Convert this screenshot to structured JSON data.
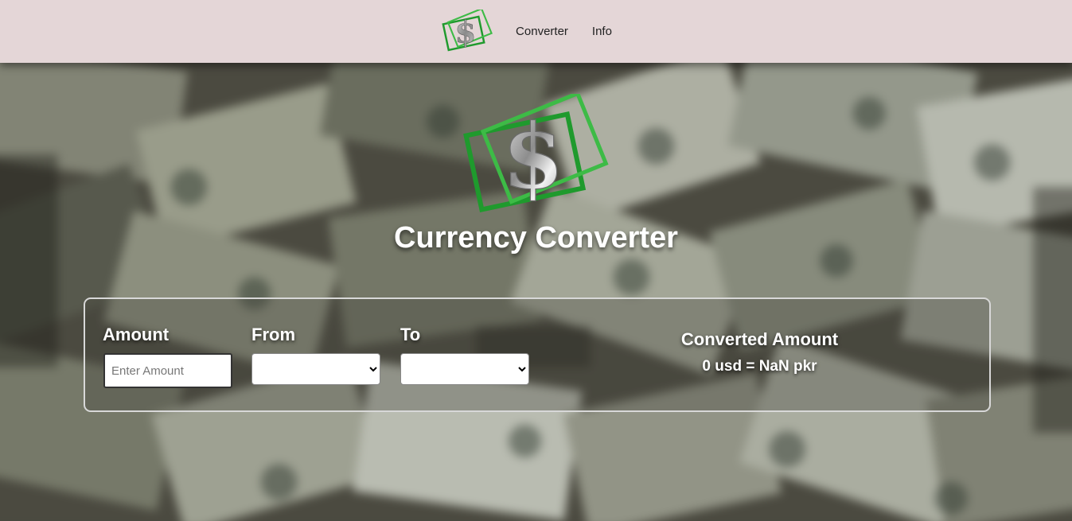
{
  "navbar": {
    "logo_icon": "dollar-logo-icon",
    "links": [
      {
        "label": "Converter"
      },
      {
        "label": "Info"
      }
    ]
  },
  "hero": {
    "logo_icon": "dollar-logo-icon",
    "title": "Currency Converter"
  },
  "converter": {
    "amount_label": "Amount",
    "amount_placeholder": "Enter Amount",
    "amount_value": "",
    "from_label": "From",
    "from_selected": "",
    "to_label": "To",
    "to_selected": "",
    "converted_title": "Converted Amount",
    "converted_result": "0 usd = NaN pkr"
  },
  "colors": {
    "navbar_bg": "#e4d6d7",
    "accent_green": "#2faa3a",
    "text_white": "#ffffff"
  }
}
